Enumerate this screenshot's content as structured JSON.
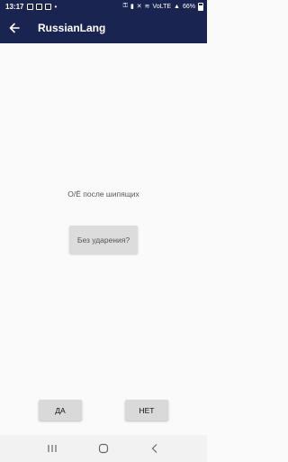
{
  "status_bar": {
    "time": "13:17",
    "network": "VoLTE",
    "battery": "66%"
  },
  "app_bar": {
    "title": "RussianLang"
  },
  "main": {
    "question": "О/Ё после шипящих",
    "hint_button": "Без ударения?"
  },
  "answers": {
    "yes": "ДА",
    "no": "НЕТ"
  },
  "colors": {
    "app_bar": "#1a2450",
    "background": "#fafafa",
    "button": "#dcdcdc"
  }
}
